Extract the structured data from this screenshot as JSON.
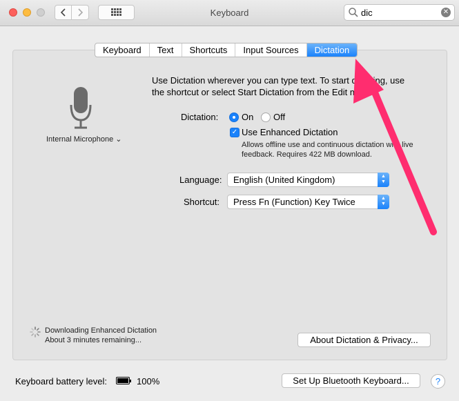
{
  "window": {
    "title": "Keyboard"
  },
  "search": {
    "value": "dic",
    "clear_icon": "clear-icon"
  },
  "tabs": [
    {
      "label": "Keyboard"
    },
    {
      "label": "Text"
    },
    {
      "label": "Shortcuts"
    },
    {
      "label": "Input Sources"
    },
    {
      "label": "Dictation",
      "active": true
    }
  ],
  "microphone": {
    "label": "Internal Microphone ⌄",
    "icon": "microphone-icon"
  },
  "intro_text": "Use Dictation wherever you can type text. To start dictating, use the shortcut or select Start Dictation from the Edit menu.",
  "dictation": {
    "label": "Dictation:",
    "on_label": "On",
    "off_label": "Off",
    "selected": "On",
    "enhanced_label": "Use Enhanced Dictation",
    "enhanced_checked": true,
    "enhanced_note": "Allows offline use and continuous dictation with live feedback. Requires 422 MB download."
  },
  "language": {
    "label": "Language:",
    "value": "English (United Kingdom)"
  },
  "shortcut": {
    "label": "Shortcut:",
    "value": "Press Fn (Function) Key Twice"
  },
  "download": {
    "line1": "Downloading Enhanced Dictation",
    "line2": "About 3 minutes remaining..."
  },
  "buttons": {
    "about": "About Dictation & Privacy...",
    "bluetooth": "Set Up Bluetooth Keyboard...",
    "help": "?"
  },
  "battery": {
    "label": "Keyboard battery level:",
    "value": "100%"
  },
  "colors": {
    "accent": "#1a82fb",
    "annotation_arrow": "#ff2d6f"
  }
}
